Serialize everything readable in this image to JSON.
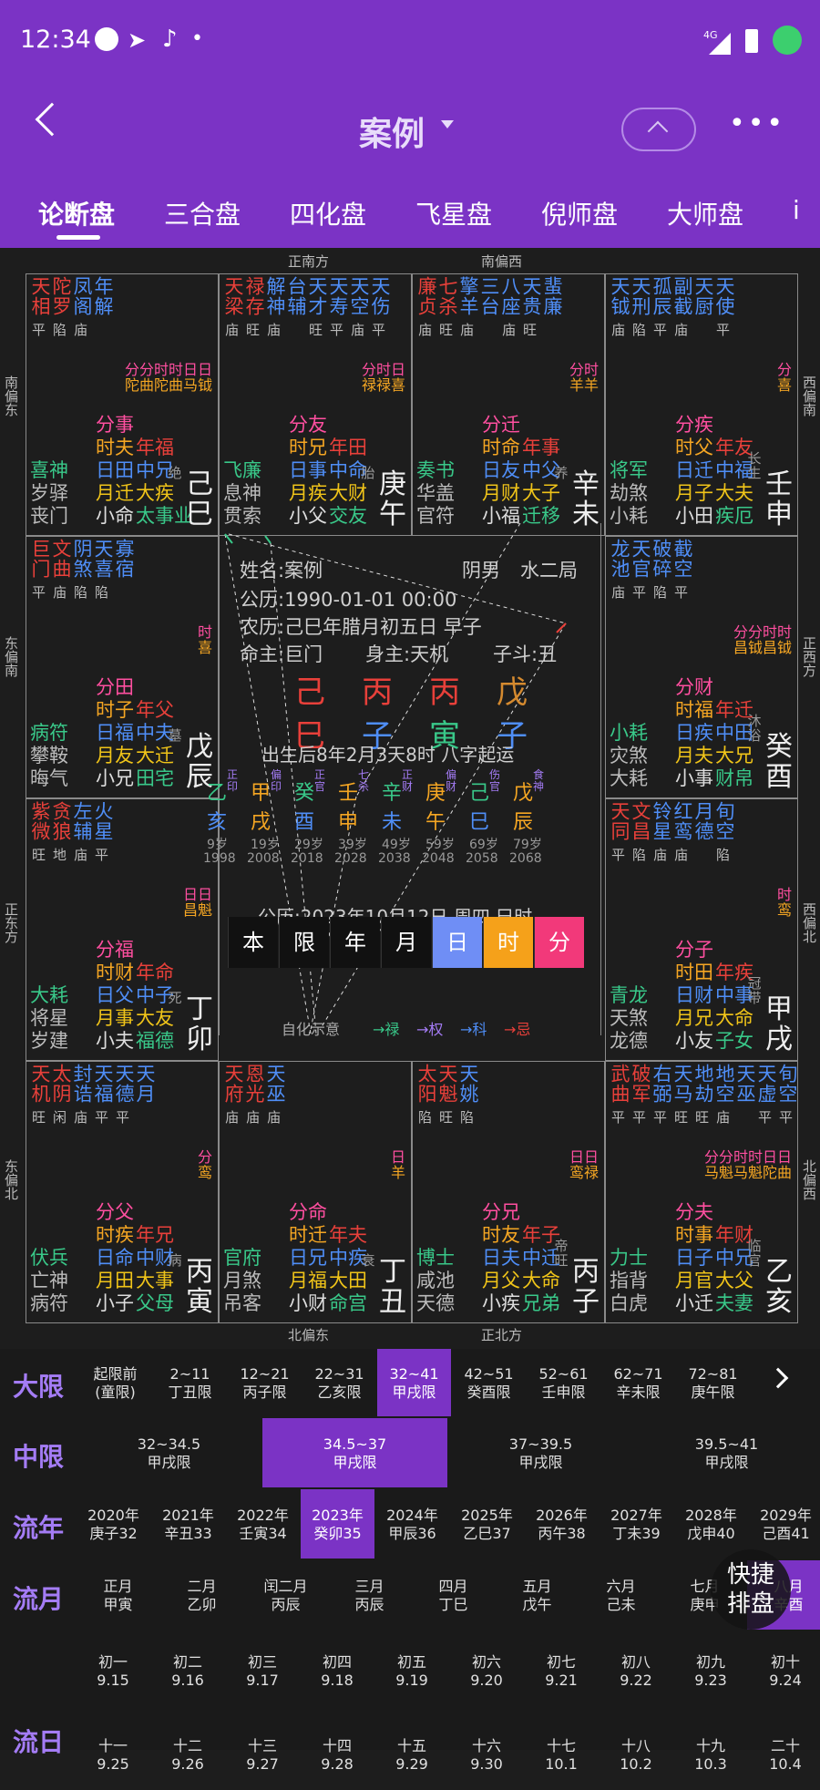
{
  "status": {
    "time": "12:34",
    "signal": "4G"
  },
  "header": {
    "title": "案例",
    "tabs": [
      "论断盘",
      "三合盘",
      "四化盘",
      "飞星盘",
      "倪师盘",
      "大师盘",
      "i"
    ]
  },
  "directions": {
    "top1": "正南方",
    "top2": "南偏西",
    "bottom1": "北偏东",
    "bottom2": "正北方",
    "left1": "南偏东",
    "left2": "东偏南",
    "left3": "正东方",
    "left4": "东偏北",
    "right1": "西偏南",
    "right2": "正西方",
    "right3": "西偏北",
    "right4": "北偏西"
  },
  "palaces": [
    {
      "stars": [
        [
          "天",
          "相"
        ],
        [
          "陀",
          "罗"
        ],
        [
          "凤",
          "阁"
        ],
        [
          "年",
          "解"
        ]
      ],
      "br": [
        "平",
        "陷",
        "庙"
      ],
      "hints": [
        "分分时时日日",
        "陀曲陀曲马钺"
      ],
      "g1": [
        "分事",
        "时夫",
        "日田",
        "月迁",
        "小命"
      ],
      "g2": [
        "年福",
        "中兄",
        "大疾",
        "太事业"
      ],
      "gods": [
        "喜神",
        "岁驿",
        "丧门"
      ],
      "sc": "绝",
      "gz": "己巳"
    },
    {
      "stars": [
        [
          "天",
          "梁"
        ],
        [
          "禄",
          "存"
        ],
        [
          "解",
          "神"
        ],
        [
          "台",
          "辅"
        ],
        [
          "天",
          "才"
        ],
        [
          "天",
          "寿"
        ],
        [
          "天",
          "空"
        ],
        [
          "天",
          "伤"
        ]
      ],
      "br": [
        "庙",
        "旺",
        "庙",
        "",
        "旺",
        "平",
        "庙",
        "平"
      ],
      "hints": [
        "分时日",
        "禄禄喜"
      ],
      "g1": [
        "分友",
        "时兄",
        "日事",
        "月疾",
        "小父"
      ],
      "g2": [
        "年田",
        "中命",
        "大财",
        "交友"
      ],
      "gods": [
        "飞廉",
        "息神",
        "贯索"
      ],
      "sc": "胎",
      "gz": "庚午"
    },
    {
      "stars": [
        [
          "廉",
          "贞"
        ],
        [
          "七",
          "杀"
        ],
        [
          "擎",
          "羊"
        ],
        [
          "三",
          "台"
        ],
        [
          "八",
          "座"
        ],
        [
          "天",
          "贵"
        ],
        [
          "蜚",
          "廉"
        ]
      ],
      "br": [
        "庙",
        "旺",
        "庙",
        "",
        "庙",
        "旺"
      ],
      "hints": [
        "分时",
        "羊羊"
      ],
      "g1": [
        "分迁",
        "时命",
        "日友",
        "月财",
        "小福"
      ],
      "g2": [
        "年事",
        "中父",
        "大子",
        "迁移"
      ],
      "gods": [
        "奏书",
        "华盖",
        "官符"
      ],
      "sc": "养",
      "gz": "辛未"
    },
    {
      "stars": [
        [
          "天",
          "钺"
        ],
        [
          "天",
          "刑"
        ],
        [
          "孤",
          "辰"
        ],
        [
          "副",
          "截"
        ],
        [
          "天",
          "厨"
        ],
        [
          "天",
          "使"
        ]
      ],
      "br": [
        "庙",
        "陷",
        "平",
        "庙",
        "",
        "平"
      ],
      "hints": [
        "分",
        "喜"
      ],
      "g1": [
        "分疾",
        "时父",
        "日迁",
        "月子",
        "小田"
      ],
      "g2": [
        "年友",
        "中福",
        "大夫",
        "疾厄"
      ],
      "gods": [
        "将军",
        "劫煞",
        "小耗"
      ],
      "sc": "长生",
      "gz": "壬申"
    },
    {
      "stars": [
        [
          "巨",
          "门"
        ],
        [
          "文",
          "曲"
        ],
        [
          "阴",
          "煞"
        ],
        [
          "天",
          "喜"
        ],
        [
          "寡",
          "宿"
        ]
      ],
      "br": [
        "平",
        "庙",
        "陷",
        "陷"
      ],
      "hints": [
        "时",
        "喜"
      ],
      "g1": [
        "分田",
        "时子",
        "日福",
        "月友",
        "小兄"
      ],
      "g2": [
        "年父",
        "中夫",
        "大迁",
        "田宅"
      ],
      "gods": [
        "病符",
        "攀鞍",
        "晦气"
      ],
      "sc": "墓",
      "gz": "戊辰"
    },
    {
      "stars": [
        [
          "龙",
          "池"
        ],
        [
          "天",
          "官"
        ],
        [
          "破",
          "碎"
        ],
        [
          "截",
          "空"
        ]
      ],
      "br": [
        "庙",
        "平",
        "陷",
        "平"
      ],
      "hints": [
        "分分时时",
        "昌钺昌钺"
      ],
      "g1": [
        "分财",
        "时福",
        "日疾",
        "月夫",
        "小事"
      ],
      "g2": [
        "年迁",
        "中田",
        "大兄",
        "财帛"
      ],
      "gods": [
        "小耗",
        "灾煞",
        "大耗"
      ],
      "sc": "沐浴",
      "gz": "癸酉"
    },
    {
      "stars": [
        [
          "紫",
          "微"
        ],
        [
          "贪",
          "狼"
        ],
        [
          "左",
          "辅"
        ],
        [
          "火",
          "星"
        ]
      ],
      "br": [
        "旺",
        "地",
        "庙",
        "平"
      ],
      "hints": [
        "日日",
        "昌魁"
      ],
      "g1": [
        "分福",
        "时财",
        "日父",
        "月事",
        "小夫"
      ],
      "g2": [
        "年命",
        "中子",
        "大友",
        "福德"
      ],
      "gods": [
        "大耗",
        "将星",
        "岁建"
      ],
      "sc": "死",
      "gz": "丁卯"
    },
    {
      "stars": [
        [
          "天",
          "同"
        ],
        [
          "文",
          "昌"
        ],
        [
          "铃",
          "星"
        ],
        [
          "红",
          "鸾"
        ],
        [
          "月",
          "德"
        ],
        [
          "旬",
          "空"
        ]
      ],
      "br": [
        "平",
        "陷",
        "庙",
        "庙",
        "",
        "陷"
      ],
      "hints": [
        "时",
        "鸾"
      ],
      "g1": [
        "分子",
        "时田",
        "日财",
        "月兄",
        "小友"
      ],
      "g2": [
        "年疾",
        "中事",
        "大命",
        "子女"
      ],
      "gods": [
        "青龙",
        "天煞",
        "龙德"
      ],
      "sc": "冠带",
      "gz": "甲戌"
    },
    {
      "stars": [
        [
          "天",
          "机"
        ],
        [
          "太",
          "阴"
        ],
        [
          "封",
          "诰"
        ],
        [
          "天",
          "福"
        ],
        [
          "天",
          "德"
        ],
        [
          "天",
          "月"
        ]
      ],
      "br": [
        "旺",
        "闲",
        "庙",
        "平",
        "平"
      ],
      "hints": [
        "分",
        "鸾"
      ],
      "g1": [
        "分父",
        "时疾",
        "日命",
        "月田",
        "小子"
      ],
      "g2": [
        "年兄",
        "中财",
        "大事",
        "父母"
      ],
      "gods": [
        "伏兵",
        "亡神",
        "病符"
      ],
      "sc": "病",
      "gz": "丙寅"
    },
    {
      "stars": [
        [
          "天",
          "府"
        ],
        [
          "恩",
          "光"
        ],
        [
          "天",
          "巫"
        ]
      ],
      "br": [
        "庙",
        "庙",
        "庙"
      ],
      "hints": [
        "日",
        "羊"
      ],
      "g1": [
        "分命",
        "时迁",
        "日兄",
        "月福",
        "小财"
      ],
      "g2": [
        "年夫",
        "中疾",
        "大田",
        "命宫"
      ],
      "gods": [
        "官府",
        "月煞",
        "吊客"
      ],
      "sc": "衰",
      "gz": "丁丑"
    },
    {
      "stars": [
        [
          "太",
          "阳"
        ],
        [
          "天",
          "魁"
        ],
        [
          "天",
          "姚"
        ]
      ],
      "br": [
        "陷",
        "旺",
        "陷"
      ],
      "hints": [
        "日日",
        "鸾禄"
      ],
      "g1": [
        "分兄",
        "时友",
        "日夫",
        "月父",
        "小疾"
      ],
      "g2": [
        "年子",
        "中迁",
        "大命",
        "兄弟"
      ],
      "gods": [
        "博士",
        "咸池",
        "天德"
      ],
      "sc": "帝旺",
      "gz": "丙子"
    },
    {
      "stars": [
        [
          "武",
          "曲"
        ],
        [
          "破",
          "军"
        ],
        [
          "右",
          "弼"
        ],
        [
          "天",
          "马"
        ],
        [
          "地",
          "劫"
        ],
        [
          "地",
          "空"
        ],
        [
          "天",
          "巫"
        ],
        [
          "天",
          "虚"
        ],
        [
          "旬",
          "空"
        ]
      ],
      "br": [
        "平",
        "平",
        "平",
        "旺",
        "旺",
        "庙",
        "",
        "平",
        "平"
      ],
      "hints": [
        "分分时时日日",
        "马魁马魁陀曲"
      ],
      "g1": [
        "分夫",
        "时事",
        "日子",
        "月官",
        "小迁"
      ],
      "g2": [
        "年财",
        "中兄",
        "大父",
        "夫妻"
      ],
      "gods": [
        "力士",
        "指背",
        "白虎"
      ],
      "sc": "临官",
      "gz": "乙亥"
    }
  ],
  "center": {
    "name": "姓名:案例",
    "gender": "阴男",
    "ju": "水二局",
    "solar": "公历:1990-01-01 00:00",
    "lunar": "农历:己巳年腊月初五日 早子",
    "ming": "命主:巨门",
    "shen": "身主:天机",
    "zidou": "子斗:丑",
    "gan": [
      "己",
      "丙",
      "丙",
      "戊"
    ],
    "zhi": [
      "巳",
      "子",
      "寅",
      "子"
    ],
    "qiyun": "出生后8年2月3天8时 八字起运",
    "dy_top": [
      "乙",
      "正印",
      "甲",
      "偏印",
      "癸",
      "正官",
      "壬",
      "七杀",
      "辛",
      "正财",
      "庚",
      "偏财",
      "己",
      "伤官",
      "戊",
      "食神"
    ],
    "dy_zhi": [
      "亥",
      "戌",
      "酉",
      "申",
      "未",
      "午",
      "巳",
      "辰"
    ],
    "dy_age": [
      "9岁",
      "19岁",
      "29岁",
      "39岁",
      "49岁",
      "59岁",
      "69岁",
      "79岁"
    ],
    "dy_year": [
      "1998",
      "2008",
      "2018",
      "2028",
      "2038",
      "2048",
      "2058",
      "2068"
    ],
    "today": "公历:2023年10月12日 周四 巳时",
    "buttons": [
      "本",
      "限",
      "年",
      "月",
      "日",
      "时",
      "分"
    ],
    "legend": [
      "自化示意",
      "→禄",
      "→权",
      "→科",
      "→忌"
    ]
  },
  "daxian": {
    "label": "大限",
    "items": [
      [
        "起限前",
        "(童限)"
      ],
      [
        "2~11",
        "丁丑限"
      ],
      [
        "12~21",
        "丙子限"
      ],
      [
        "22~31",
        "乙亥限"
      ],
      [
        "32~41",
        "甲戌限"
      ],
      [
        "42~51",
        "癸酉限"
      ],
      [
        "52~61",
        "壬申限"
      ],
      [
        "62~71",
        "辛未限"
      ],
      [
        "72~81",
        "庚午限"
      ]
    ]
  },
  "zhongxian": {
    "label": "中限",
    "items": [
      [
        "32~34.5",
        "甲戌限"
      ],
      [
        "34.5~37",
        "甲戌限"
      ],
      [
        "37~39.5",
        "甲戌限"
      ],
      [
        "39.5~41",
        "甲戌限"
      ]
    ]
  },
  "liunian": {
    "label": "流年",
    "items": [
      [
        "2020年",
        "庚子32"
      ],
      [
        "2021年",
        "辛丑33"
      ],
      [
        "2022年",
        "壬寅34"
      ],
      [
        "2023年",
        "癸卯35"
      ],
      [
        "2024年",
        "甲辰36"
      ],
      [
        "2025年",
        "乙巳37"
      ],
      [
        "2026年",
        "丙午38"
      ],
      [
        "2027年",
        "丁未39"
      ],
      [
        "2028年",
        "戊申40"
      ],
      [
        "2029年",
        "己酉41"
      ]
    ]
  },
  "liuyue": {
    "label": "流月",
    "items": [
      [
        "正月",
        "甲寅"
      ],
      [
        "二月",
        "乙卯"
      ],
      [
        "闰二月",
        "丙辰"
      ],
      [
        "三月",
        "丙辰"
      ],
      [
        "四月",
        "丁巳"
      ],
      [
        "五月",
        "戊午"
      ],
      [
        "六月",
        "己未"
      ],
      [
        "七月",
        "庚申"
      ],
      [
        "八月",
        "辛酉"
      ]
    ]
  },
  "liuri": {
    "label": "流日",
    "row1": [
      [
        "初一",
        "9.15"
      ],
      [
        "初二",
        "9.16"
      ],
      [
        "初三",
        "9.17"
      ],
      [
        "初四",
        "9.18"
      ],
      [
        "初五",
        "9.19"
      ],
      [
        "初六",
        "9.20"
      ],
      [
        "初七",
        "9.21"
      ],
      [
        "初八",
        "9.22"
      ],
      [
        "初九",
        "9.23"
      ],
      [
        "初十",
        "9.24"
      ]
    ],
    "row2": [
      [
        "十一",
        "9.25"
      ],
      [
        "十二",
        "9.26"
      ],
      [
        "十三",
        "9.27"
      ],
      [
        "十四",
        "9.28"
      ],
      [
        "十五",
        "9.29"
      ],
      [
        "十六",
        "9.30"
      ],
      [
        "十七",
        "10.1"
      ],
      [
        "十八",
        "10.2"
      ],
      [
        "十九",
        "10.3"
      ],
      [
        "二十",
        "10.4"
      ]
    ]
  },
  "fab": "快捷排盘",
  "colors": {
    "accent": "#7b33c5",
    "red": "#e8403a",
    "blue": "#4f8ef7",
    "gold": "#f0c419",
    "green": "#39c889",
    "pink": "#ff4fa0"
  }
}
